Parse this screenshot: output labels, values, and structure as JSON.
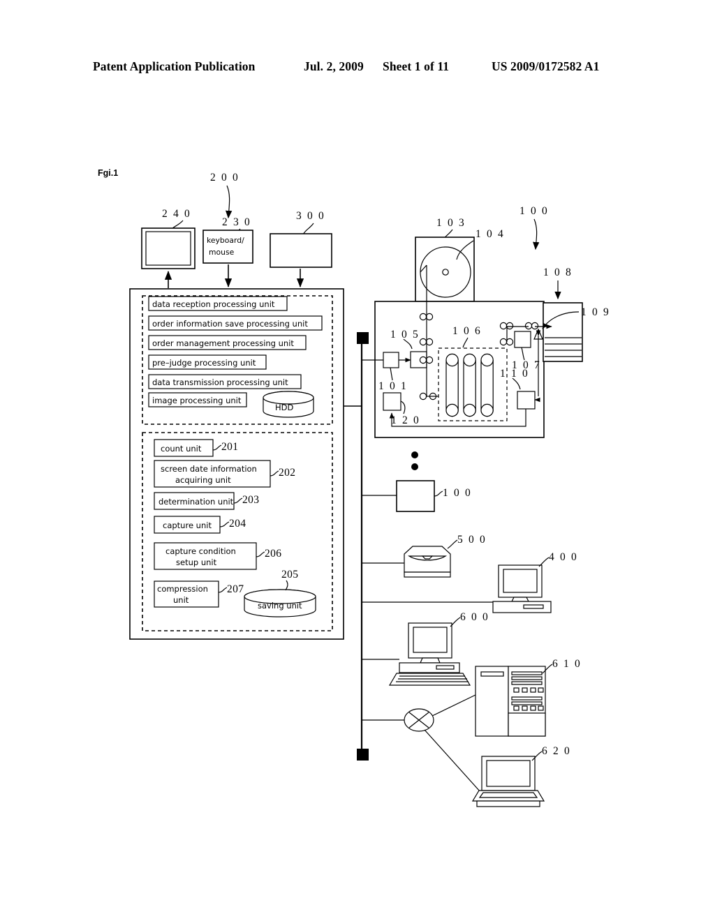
{
  "header": {
    "publication": "Patent Application Publication",
    "date": "Jul. 2, 2009",
    "sheet": "Sheet 1 of 11",
    "patent_number": "US 2009/0172582 A1"
  },
  "figure": {
    "label": "Fgi.1"
  },
  "input_devices": {
    "monitor": {
      "ref": "2 4 0",
      "label": ""
    },
    "keyboard_mouse": {
      "ref": "2 3 0",
      "label_line1": "keyboard∕",
      "label_line2": "mouse"
    },
    "other_device": {
      "ref": "3 0 0",
      "label": ""
    },
    "system_ref": "2 0 0"
  },
  "server_box": {
    "upper_group": {
      "items": [
        "data reception processing unit",
        "order information save processing unit",
        "order management processing unit",
        "pre–judge processing unit",
        "data transmission processing unit",
        "image processing unit"
      ],
      "storage": "HDD"
    },
    "lower_group": {
      "items": [
        {
          "label": "count unit",
          "ref": "201",
          "lines": 1
        },
        {
          "label": "screen date information acquiring unit",
          "line1": "screen date information",
          "line2": "acquiring unit",
          "ref": "202",
          "lines": 2
        },
        {
          "label": "determination unit",
          "ref": "203",
          "lines": 1
        },
        {
          "label": "capture unit",
          "ref": "204",
          "lines": 1
        },
        {
          "label": "capture condition setup unit",
          "line1": "capture condition",
          "line2": "setup unit",
          "ref": "206",
          "lines": 2
        },
        {
          "label": "compression unit",
          "line1": "compression",
          "line2": "unit",
          "ref": "207",
          "lines": 2
        }
      ],
      "storage": {
        "label": "saving unit",
        "ref": "205"
      }
    }
  },
  "processor_apparatus": {
    "ref_main": "1 0 0",
    "refs": {
      "film_supply_box": "1 0 3",
      "film_roll": "1 0 4",
      "feed_unit": "1 0 1",
      "roller_unit": "1 0 5",
      "processing_tank": "1 0 6",
      "drying_unit": "1 0 7",
      "stacker": "1 0 8",
      "prints": "1 0 9",
      "return_unit": "1 1 0",
      "lower_unit": "1 2 0"
    }
  },
  "network_devices": [
    {
      "ref": "1 0 0",
      "name": "second-processor"
    },
    {
      "ref": "5 0 0",
      "name": "printer"
    },
    {
      "ref": "4 0 0",
      "name": "desktop-computer"
    },
    {
      "ref": "6 0 0",
      "name": "workstation-computer"
    },
    {
      "ref": "6 1 0",
      "name": "server-tower"
    },
    {
      "ref": "6 2 0",
      "name": "laptop-computer"
    }
  ],
  "colors": {
    "ink": "#000000",
    "paper": "#ffffff"
  }
}
